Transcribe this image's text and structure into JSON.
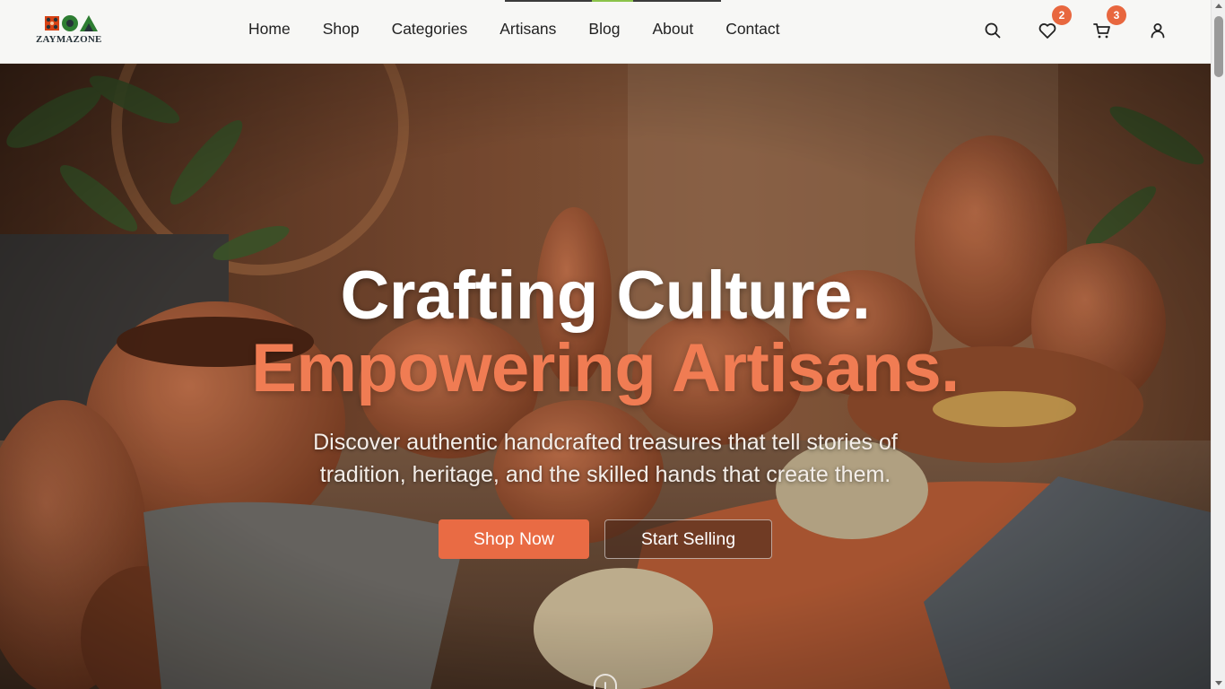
{
  "brand": {
    "name": "ZAYMAZONE",
    "colors": {
      "accent": "#e96b44",
      "title_orange": "#f07c53",
      "badge": "#e8673f",
      "logo_green": "#2e7d32",
      "logo_red": "#d84315",
      "logo_dark": "#263238"
    }
  },
  "nav": {
    "items": [
      {
        "label": "Home"
      },
      {
        "label": "Shop"
      },
      {
        "label": "Categories"
      },
      {
        "label": "Artisans"
      },
      {
        "label": "Blog"
      },
      {
        "label": "About"
      },
      {
        "label": "Contact"
      }
    ]
  },
  "header_icons": {
    "search": "search-icon",
    "wishlist": {
      "icon": "heart-icon",
      "count": "2"
    },
    "cart": {
      "icon": "cart-icon",
      "count": "3"
    },
    "account": "user-icon"
  },
  "hero": {
    "title_line_1": "Crafting Culture.",
    "title_line_2": "Empowering Artisans.",
    "subtitle_line_1": "Discover authentic handcrafted treasures that tell stories of",
    "subtitle_line_2": "tradition, heritage, and the skilled hands that create them.",
    "primary_button": "Shop Now",
    "secondary_button": "Start Selling",
    "scroll_icon": "mouse-scroll-icon"
  }
}
